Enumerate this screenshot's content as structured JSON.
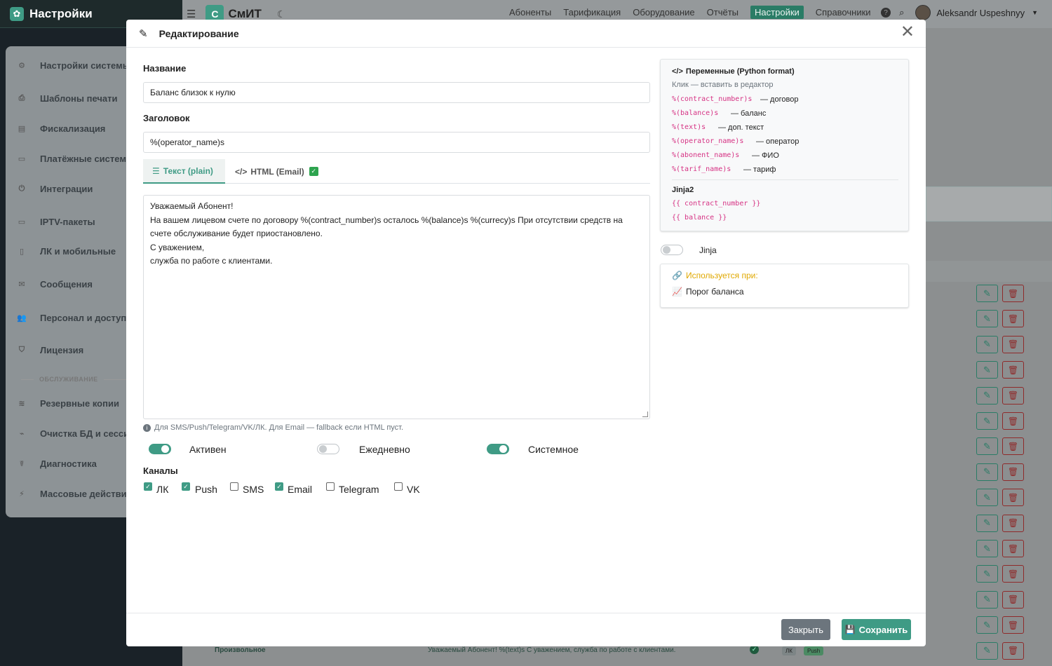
{
  "app": {
    "sidebar_title": "Настройки",
    "brand_letter": "С",
    "brand_name": "СмИТ"
  },
  "topnav": [
    "Абоненты",
    "Тарификация",
    "Оборудование",
    "Отчёты",
    "Настройки",
    "Справочники"
  ],
  "topnav_active": "Настройки",
  "user": {
    "name": "Aleksandr Uspeshnyy",
    "help": "?"
  },
  "sidebar": {
    "items": [
      {
        "label": "Настройки системы",
        "icon": "gears-icon"
      },
      {
        "label": "Шаблоны печати",
        "icon": "printer-icon"
      },
      {
        "label": "Фискализация",
        "icon": "cash-register-icon"
      },
      {
        "label": "Платёжные системы",
        "icon": "credit-card-icon"
      },
      {
        "label": "Интеграции",
        "icon": "plug-icon"
      },
      {
        "label": "IPTV-пакеты",
        "icon": "tv-icon"
      },
      {
        "label": "ЛК и мобильные",
        "icon": "mobile-icon"
      },
      {
        "label": "Сообщения",
        "icon": "envelope-icon"
      },
      {
        "label": "Персонал и доступ",
        "icon": "users-icon"
      },
      {
        "label": "Лицензия",
        "icon": "shield-icon"
      }
    ],
    "section": "ОБСЛУЖИВАНИЕ",
    "items2": [
      {
        "label": "Резервные копии",
        "icon": "database-icon"
      },
      {
        "label": "Очистка БД и сессий",
        "icon": "broom-icon"
      },
      {
        "label": "Диагностика",
        "icon": "stethoscope-icon"
      },
      {
        "label": "Массовые действия",
        "icon": "bolt-icon"
      }
    ]
  },
  "background_row": {
    "name": "Произвольное",
    "text": "Уважаемый Абонент! %(text)s С уважением, служба по работе с клиентами.",
    "badges": [
      "ЛК",
      "Push"
    ]
  },
  "modal": {
    "title": "Редактирование",
    "name_label": "Название",
    "name_value": "Баланс близок к нулю",
    "subject_label": "Заголовок",
    "subject_value": "%(operator_name)s",
    "tabs": [
      {
        "label": "Текст (plain)",
        "icon": "text-lines-icon",
        "active": true
      },
      {
        "label": "HTML (Email)",
        "icon": "code-icon",
        "active": false,
        "check": "✓"
      }
    ],
    "body_lines": [
      "Уважаемый Абонент!",
      "На вашем лицевом счете по договору %(contract_number)s осталось %(balance)s %(currecy)s При отсутствии средств на",
      "счете обслуживание будет приостановлено.",
      "С уважением,",
      "служба по работе с клиентами."
    ],
    "hint": "Для SMS/Push/Telegram/VK/ЛК. Для Email — fallback если HTML пуст.",
    "toggles": [
      {
        "label": "Активен",
        "on": true
      },
      {
        "label": "Ежедневно",
        "on": false
      },
      {
        "label": "Системное",
        "on": true
      }
    ],
    "channels_label": "Каналы",
    "channels": [
      {
        "label": "ЛК",
        "checked": true
      },
      {
        "label": "Push",
        "checked": true
      },
      {
        "label": "SMS",
        "checked": false
      },
      {
        "label": "Email",
        "checked": true
      },
      {
        "label": "Telegram",
        "checked": false
      },
      {
        "label": "VK",
        "checked": false
      }
    ],
    "close_label": "Закрыть",
    "save_label": "Сохранить",
    "vars": {
      "title": "Переменные (Python format)",
      "subtitle": "Клик — вставить в редактор",
      "items": [
        {
          "code": "%(contract_number)s",
          "desc": "— договор"
        },
        {
          "code": "%(balance)s",
          "desc": "— баланс"
        },
        {
          "code": "%(text)s",
          "desc": "— доп. текст"
        },
        {
          "code": "%(operator_name)s",
          "desc": "— оператор"
        },
        {
          "code": "%(abonent_name)s",
          "desc": "— ФИО"
        },
        {
          "code": "%(tarif_name)s",
          "desc": "— тариф"
        }
      ],
      "jinja_title": "Jinja2",
      "jinja_items": [
        "{{ contract_number }}",
        "{{ balance }}"
      ]
    },
    "jinja_toggle": {
      "label": "Jinja",
      "on": false
    },
    "used": {
      "title": "Используется при:",
      "item": "Порог баланса"
    }
  },
  "colors": {
    "accent": "#3f9b85",
    "danger": "#8f2a2a",
    "code": "#d63384",
    "warn": "#e0a800"
  }
}
